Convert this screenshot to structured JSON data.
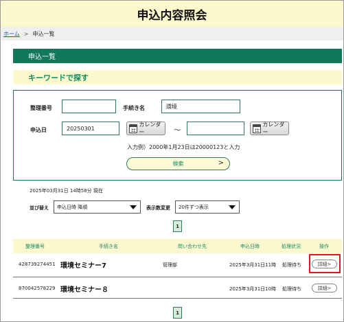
{
  "header": {
    "title": "申込内容照会"
  },
  "breadcrumb": {
    "home": "ホーム",
    "separator": ">",
    "current": "申込一覧"
  },
  "section": {
    "title": "申込一覧"
  },
  "keyword_search": {
    "title": "キーワードで探す",
    "reference_no_label": "整理番号",
    "reference_no_value": "",
    "procedure_label": "手続き名",
    "procedure_value": "環境",
    "apply_date_label": "申込日",
    "date_from_value": "20250301",
    "date_to_value": "",
    "calendar_label": "カレンダー",
    "range_separator": "～",
    "hint": "入力例）2000年1月23日は20000123と入力",
    "search_label": "検索",
    "search_arrow": ">"
  },
  "timestamp": "2025年03月31日 14時58分 現在",
  "sort": {
    "label": "並び替え",
    "selected": "申込日時 降順"
  },
  "display_count": {
    "label": "表示数変更",
    "selected": "20件ずつ表示"
  },
  "pagination": {
    "page": "1"
  },
  "table": {
    "headers": [
      "整理番号",
      "手続き名",
      "問い合わせ先",
      "申込日時",
      "処理状況",
      "操作"
    ],
    "rows": [
      {
        "ref": "428739274451",
        "name": "環境セミナー7",
        "contact": "管理部",
        "date": "2025年3月31日11時",
        "status": "処理待ち",
        "action": "詳細>"
      },
      {
        "ref": "870042578229",
        "name": "環境セミナー８",
        "contact": "",
        "date": "2025年3月31日10時",
        "status": "処理待ち",
        "action": "詳細>"
      }
    ]
  },
  "colors": {
    "primary_green": "#11785a",
    "light_yellow": "#fdf9cf",
    "highlight_red": "#e0161b"
  }
}
